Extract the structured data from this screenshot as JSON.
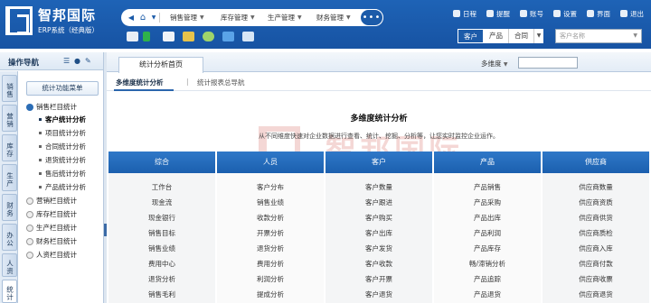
{
  "brand": {
    "title": "智邦国际",
    "subtitle": "ERP系统（经典版）"
  },
  "navbar": {
    "menus": [
      "销售管理",
      "库存管理",
      "生产管理",
      "财务管理"
    ],
    "more": "•••"
  },
  "toplinks": [
    "日程",
    "提醒",
    "账号",
    "设置",
    "界面",
    "退出"
  ],
  "search": {
    "tabs": [
      "客户",
      "产品",
      "合同"
    ],
    "placeholder": "客户名称"
  },
  "sidebar": {
    "title": "操作导航",
    "vtabs": [
      "销售",
      "营销",
      "库存",
      "生产",
      "财务",
      "办公",
      "人资",
      "统计"
    ],
    "menu_button": "统计功能菜单",
    "groups": [
      {
        "label": "销售栏目统计",
        "expanded": true,
        "items": [
          "客户统计分析",
          "项目统计分析",
          "合同统计分析",
          "退货统计分析",
          "售后统计分析",
          "产品统计分析"
        ]
      },
      {
        "label": "营销栏目统计"
      },
      {
        "label": "库存栏目统计"
      },
      {
        "label": "生产栏目统计"
      },
      {
        "label": "财务栏目统计"
      },
      {
        "label": "人资栏目统计"
      }
    ]
  },
  "main": {
    "tab": "统计分析首页",
    "dimension_label": "多维度",
    "subtabs": [
      "多维度统计分析",
      "统计报表总导航"
    ],
    "watermark": {
      "text": "智邦国际",
      "sub": "企业管理软件著名品牌"
    },
    "title": "多维度统计分析",
    "description": "从不同维度快速对企业数据进行查看、统计、挖掘、分析等，让您实时监控企业运作。",
    "columns": [
      {
        "header": "综合",
        "cells": [
          "工作台",
          "现金流",
          "现金银行",
          "销售目标",
          "销售业绩",
          "费用中心",
          "退货分析",
          "销售毛利"
        ]
      },
      {
        "header": "人员",
        "cells": [
          "客户分布",
          "销售业绩",
          "收款分析",
          "开票分析",
          "退货分析",
          "费用分析",
          "利润分析",
          "提成分析"
        ]
      },
      {
        "header": "客户",
        "cells": [
          "客户数量",
          "客户跟进",
          "客户购买",
          "客户出库",
          "客户发货",
          "客户收款",
          "客户开票",
          "客户退货"
        ]
      },
      {
        "header": "产品",
        "cells": [
          "产品销售",
          "产品采购",
          "产品出库",
          "产品利润",
          "产品库存",
          "畅/滞销分析",
          "产品追踪",
          "产品退货"
        ]
      },
      {
        "header": "供应商",
        "cells": [
          "供应商数量",
          "供应商资质",
          "供应商供货",
          "供应商质检",
          "供应商入库",
          "供应商付款",
          "供应商收票",
          "供应商退货"
        ]
      }
    ]
  }
}
